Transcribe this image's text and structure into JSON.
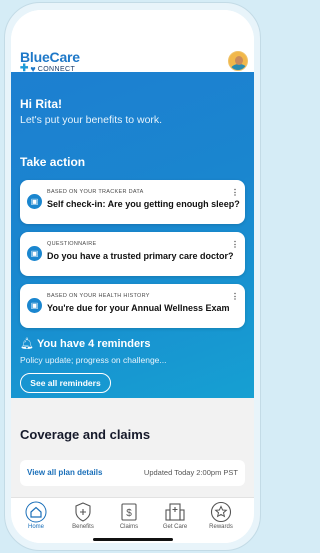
{
  "header": {
    "logo_main": "BlueCare",
    "logo_sub": "CONNECT"
  },
  "hero": {
    "greeting": "Hi Rita!",
    "subtitle": "Let's put your benefits to work.",
    "section_title": "Take action",
    "cards": [
      {
        "eyebrow": "BASED ON YOUR TRACKER DATA",
        "title": "Self check-in: Are you getting enough sleep?",
        "icon": "clipboard-icon"
      },
      {
        "eyebrow": "QUESTIONNAIRE",
        "title": "Do you have a trusted primary care doctor?",
        "icon": "clipboard-icon"
      },
      {
        "eyebrow": "BASED ON YOUR HEALTH HISTORY",
        "title": "You're due for your Annual Wellness Exam",
        "icon": "clipboard-icon"
      }
    ],
    "reminders_title": "You have 4 reminders",
    "reminders_sub": "Policy update; progress on challenge...",
    "see_all_label": "See all reminders"
  },
  "coverage": {
    "title": "Coverage and claims",
    "plan_link": "View all plan details",
    "updated": "Updated Today 2:00pm PST"
  },
  "tabs": [
    {
      "label": "Home",
      "icon": "home-icon",
      "active": true
    },
    {
      "label": "Benefits",
      "icon": "shield-plus-icon",
      "active": false
    },
    {
      "label": "Claims",
      "icon": "dollar-doc-icon",
      "active": false
    },
    {
      "label": "Get Care",
      "icon": "hospital-icon",
      "active": false
    },
    {
      "label": "Rewards",
      "icon": "star-badge-icon",
      "active": false
    }
  ],
  "colors": {
    "brand_blue": "#1e78c8",
    "hero_start": "#1d7fd0",
    "hero_end": "#16a0d2",
    "link": "#1a6fb9"
  }
}
